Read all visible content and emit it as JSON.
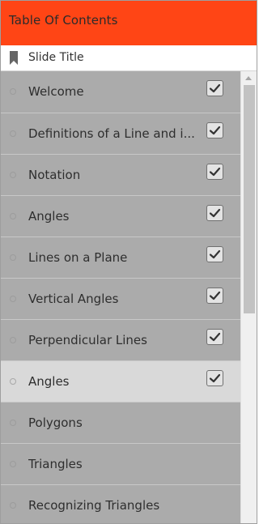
{
  "header": {
    "title": "Table Of Contents"
  },
  "subheader": {
    "label": "Slide Title"
  },
  "items": [
    {
      "label": "Welcome",
      "checked": true,
      "active": false
    },
    {
      "label": "Definitions of a Line and i...",
      "checked": true,
      "active": false
    },
    {
      "label": "Notation",
      "checked": true,
      "active": false
    },
    {
      "label": "Angles",
      "checked": true,
      "active": false
    },
    {
      "label": "Lines on a Plane",
      "checked": true,
      "active": false
    },
    {
      "label": "Vertical Angles",
      "checked": true,
      "active": false
    },
    {
      "label": "Perpendicular Lines",
      "checked": true,
      "active": false
    },
    {
      "label": "Angles",
      "checked": true,
      "active": true
    },
    {
      "label": "Polygons",
      "checked": false,
      "active": false
    },
    {
      "label": "Triangles",
      "checked": false,
      "active": false
    },
    {
      "label": "Recognizing Triangles",
      "checked": false,
      "active": false
    }
  ],
  "colors": {
    "header_bg": "#ff4515",
    "item_bg": "#ababab",
    "active_bg": "#d9d9d9"
  },
  "icons": {
    "subheader": "bookmark-icon",
    "item_marker": "circle-icon",
    "check": "checkmark-icon"
  }
}
